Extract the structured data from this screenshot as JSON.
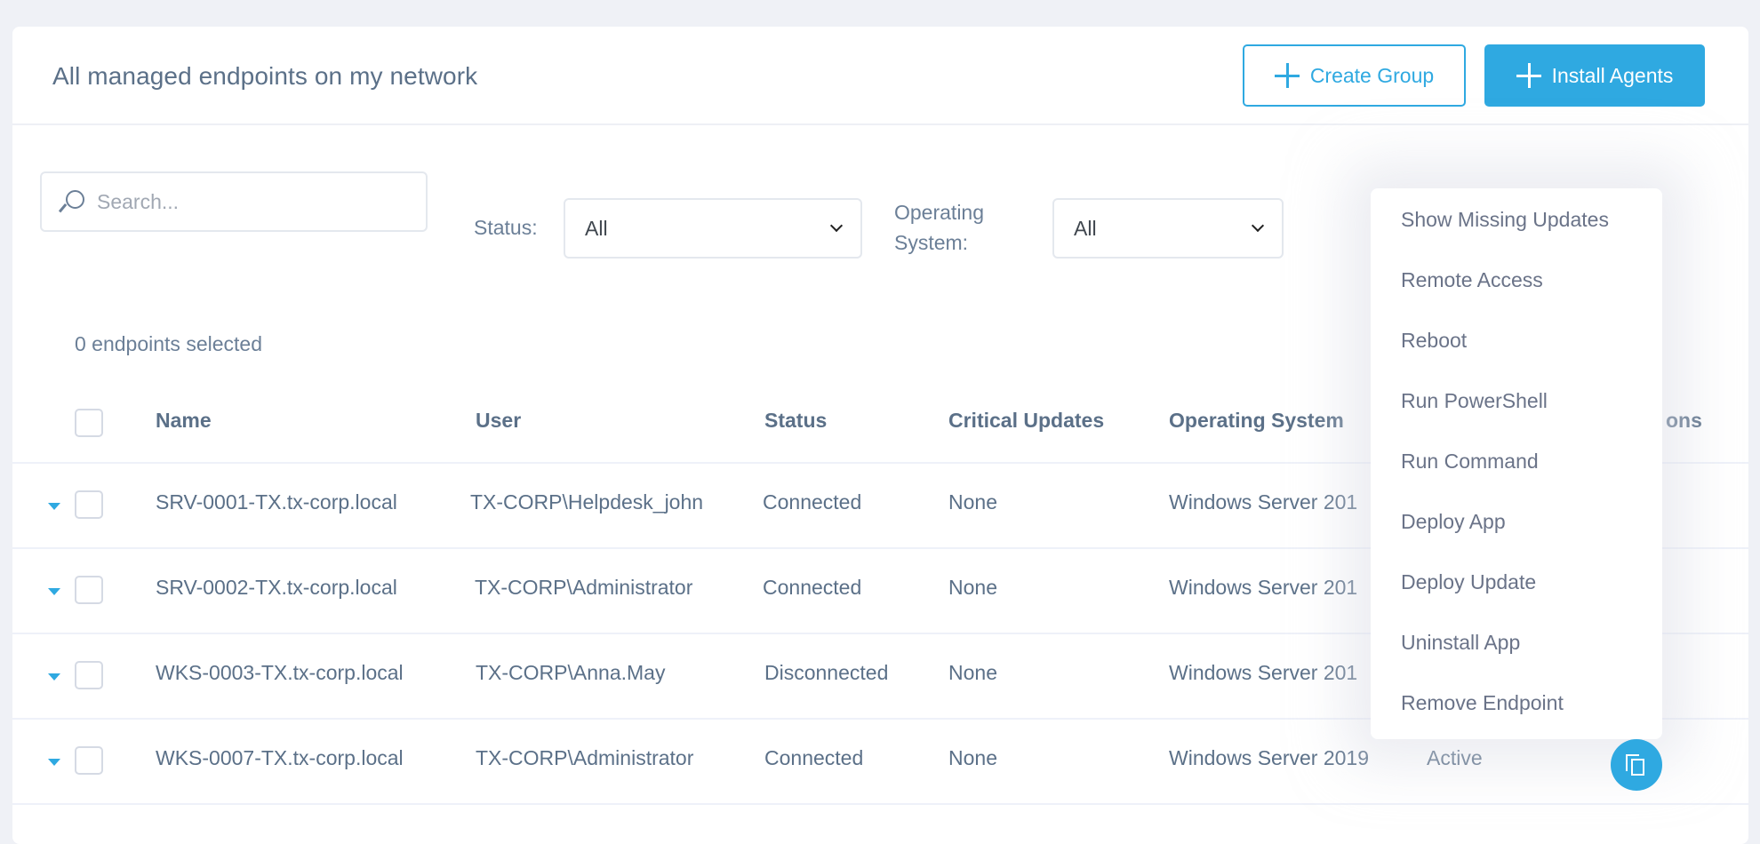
{
  "header": {
    "title": "All managed endpoints on my network",
    "create_group_label": "Create Group",
    "install_agents_label": "Install Agents"
  },
  "filters": {
    "search_placeholder": "Search...",
    "search_value": "",
    "status_label": "Status:",
    "status_value": "All",
    "os_label_line1": "Operating",
    "os_label_line2": "System:",
    "os_value": "All"
  },
  "selection": {
    "count_text": "0 endpoints selected"
  },
  "table": {
    "columns": {
      "name": "Name",
      "user": "User",
      "status": "Status",
      "critical_updates": "Critical Updates",
      "operating_system": "Operating System",
      "actions_partial": "ons"
    },
    "rows": [
      {
        "name": "SRV-0001-TX.tx-corp.local",
        "user": "TX-CORP\\Helpdesk_john",
        "status": "Connected",
        "critical_updates": "None",
        "os": "Windows Server 201",
        "agent": ""
      },
      {
        "name": "SRV-0002-TX.tx-corp.local",
        "user": "TX-CORP\\Administrator",
        "status": "Connected",
        "critical_updates": "None",
        "os": "Windows Server 201",
        "agent": ""
      },
      {
        "name": "WKS-0003-TX.tx-corp.local",
        "user": "TX-CORP\\Anna.May",
        "status": "Disconnected",
        "critical_updates": "None",
        "os": "Windows Server 201",
        "agent": ""
      },
      {
        "name": "WKS-0007-TX.tx-corp.local",
        "user": "TX-CORP\\Administrator",
        "status": "Connected",
        "critical_updates": "None",
        "os": "Windows Server 2019",
        "agent": "Active"
      }
    ]
  },
  "context_menu": {
    "items": [
      "Show Missing Updates",
      "Remote Access",
      "Reboot",
      "Run PowerShell",
      "Run Command",
      "Deploy App",
      "Deploy Update",
      "Uninstall App",
      "Remove Endpoint"
    ]
  },
  "colors": {
    "accent": "#2fa9e1",
    "text": "#5b7088",
    "background": "#eff1f6"
  }
}
